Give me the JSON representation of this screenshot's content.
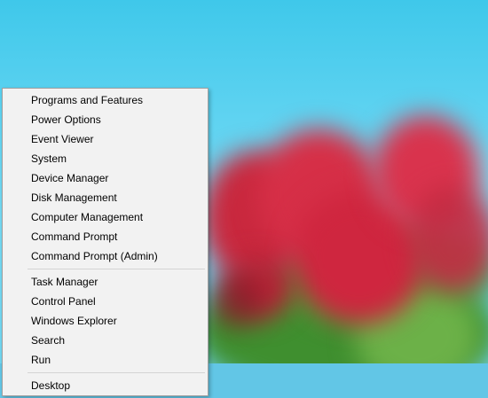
{
  "quick_link_menu": {
    "group1": [
      "Programs and Features",
      "Power Options",
      "Event Viewer",
      "System",
      "Device Manager",
      "Disk Management",
      "Computer Management",
      "Command Prompt",
      "Command Prompt (Admin)"
    ],
    "group2": [
      "Task Manager",
      "Control Panel",
      "Windows Explorer",
      "Search",
      "Run"
    ],
    "group3": [
      "Desktop"
    ]
  },
  "colors": {
    "menu_background": "#f2f2f2",
    "sky": "#5fd3f1",
    "tulip_red": "#d62f47",
    "leaf_green": "#4a9b36"
  }
}
